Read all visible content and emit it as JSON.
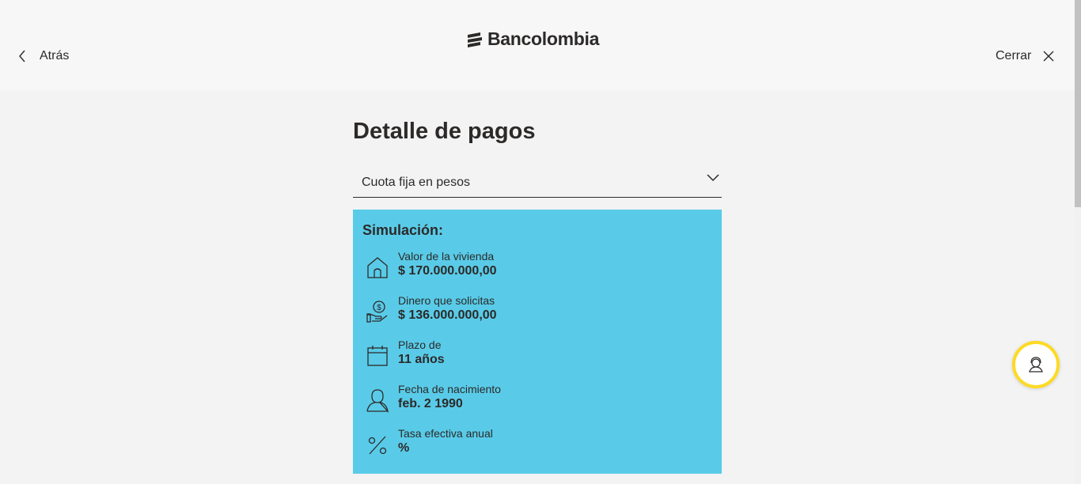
{
  "header": {
    "back_label": "Atrás",
    "brand": "Bancolombia",
    "close_label": "Cerrar"
  },
  "page": {
    "title": "Detalle de pagos"
  },
  "select": {
    "value": "Cuota fija en pesos"
  },
  "simulation": {
    "title": "Simulación:",
    "items": [
      {
        "icon": "house-icon",
        "label": "Valor de la vivienda",
        "value": "$ 170.000.000,00"
      },
      {
        "icon": "money-hand-icon",
        "label": "Dinero que solicitas",
        "value": "$ 136.000.000,00"
      },
      {
        "icon": "calendar-icon",
        "label": "Plazo de",
        "value": "11 años"
      },
      {
        "icon": "person-icon",
        "label": "Fecha de nacimiento",
        "value": "feb. 2 1990"
      },
      {
        "icon": "percent-icon",
        "label": "Tasa efectiva anual",
        "value": "%"
      }
    ]
  },
  "colors": {
    "card_bg": "#59cbe8",
    "support_ring": "#fdda24",
    "text": "#2c2a29"
  }
}
